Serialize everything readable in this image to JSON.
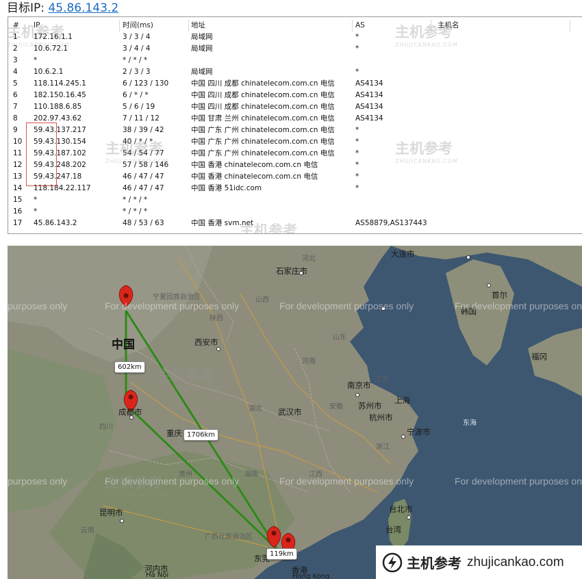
{
  "header": {
    "label": "目标IP:",
    "ip": "45.86.143.2"
  },
  "table": {
    "columns": [
      "#",
      "IP",
      "时间(ms)",
      "地址",
      "AS",
      "主机名"
    ],
    "rows": [
      [
        "1",
        "172.16.1.1",
        "3 / 3 / 4",
        "局域网",
        "*",
        ""
      ],
      [
        "2",
        "10.6.72.1",
        "3 / 4 / 4",
        "局域网",
        "*",
        ""
      ],
      [
        "3",
        "*",
        "* / * / *",
        "",
        "",
        ""
      ],
      [
        "4",
        "10.6.2.1",
        "2 / 3 / 3",
        "局域网",
        "*",
        ""
      ],
      [
        "5",
        "118.114.245.1",
        "6 / 123 / 130",
        "中国 四川 成都 chinatelecom.com.cn 电信",
        "AS4134",
        ""
      ],
      [
        "6",
        "182.150.16.45",
        "6 / * / *",
        "中国 四川 成都 chinatelecom.com.cn 电信",
        "AS4134",
        ""
      ],
      [
        "7",
        "110.188.6.85",
        "5 / 6 / 19",
        "中国 四川 成都 chinatelecom.com.cn 电信",
        "AS4134",
        ""
      ],
      [
        "8",
        "202.97.43.62",
        "7 / 11 / 12",
        "中国 甘肃 兰州 chinatelecom.com.cn 电信",
        "AS4134",
        ""
      ],
      [
        "9",
        "59.43.137.217",
        "38 / 39 / 42",
        "中国 广东 广州 chinatelecom.com.cn 电信",
        "*",
        ""
      ],
      [
        "10",
        "59.43.130.154",
        "40 / * / *",
        "中国 广东 广州 chinatelecom.com.cn 电信",
        "*",
        ""
      ],
      [
        "11",
        "59.43.187.102",
        "54 / 54 / 77",
        "中国 广东 广州 chinatelecom.com.cn 电信",
        "*",
        ""
      ],
      [
        "12",
        "59.43.248.202",
        "57 / 58 / 146",
        "中国 香港 chinatelecom.com.cn 电信",
        "*",
        ""
      ],
      [
        "13",
        "59.43.247.18",
        "46 / 47 / 47",
        "中国 香港 chinatelecom.com.cn 电信",
        "*",
        ""
      ],
      [
        "14",
        "118.184.22.117",
        "46 / 47 / 47",
        "中国 香港 51idc.com",
        "*",
        ""
      ],
      [
        "15",
        "*",
        "* / * / *",
        "",
        "",
        ""
      ],
      [
        "16",
        "*",
        "* / * / *",
        "",
        "",
        ""
      ],
      [
        "17",
        "45.86.143.2",
        "48 / 53 / 63",
        "中国 香港 svm.net",
        "AS58879,AS137443",
        ""
      ]
    ]
  },
  "watermark": {
    "cn": "主机参考",
    "en": "ZHUJICANKAO.COM"
  },
  "map": {
    "dev_text": "For development purposes only",
    "dev_text_clipped": "purposes only",
    "cities": [
      "大连市",
      "石家庄市",
      "首尔",
      "西安市",
      "成都市",
      "重庆",
      "武汉市",
      "南京市",
      "苏州市",
      "上海",
      "杭州市",
      "宁波市",
      "福冈",
      "昆明市",
      "台北市",
      "台湾",
      "香港",
      "东莞",
      "河内市",
      "中国",
      "韩国"
    ],
    "provinces": [
      "宁夏回族自治区",
      "甘肃",
      "山西",
      "陕西",
      "河北",
      "河南",
      "湖北",
      "江苏",
      "安徽",
      "浙江",
      "四川",
      "贵州",
      "江西",
      "云南",
      "湖南",
      "广西壮族自治区",
      "东海",
      "山东",
      "Hong Kong",
      "Hà Nội",
      "鄂"
    ],
    "distances": [
      "602km",
      "1706km",
      "119km"
    ]
  },
  "brand": {
    "name": "主机参考",
    "url": "zhujicankao.com"
  },
  "colors": {
    "link": "#1a6bc4",
    "route": "#2e8a17",
    "pin": "#d9261c",
    "ocean": "#3e5770",
    "highlight": "#d9534f"
  }
}
